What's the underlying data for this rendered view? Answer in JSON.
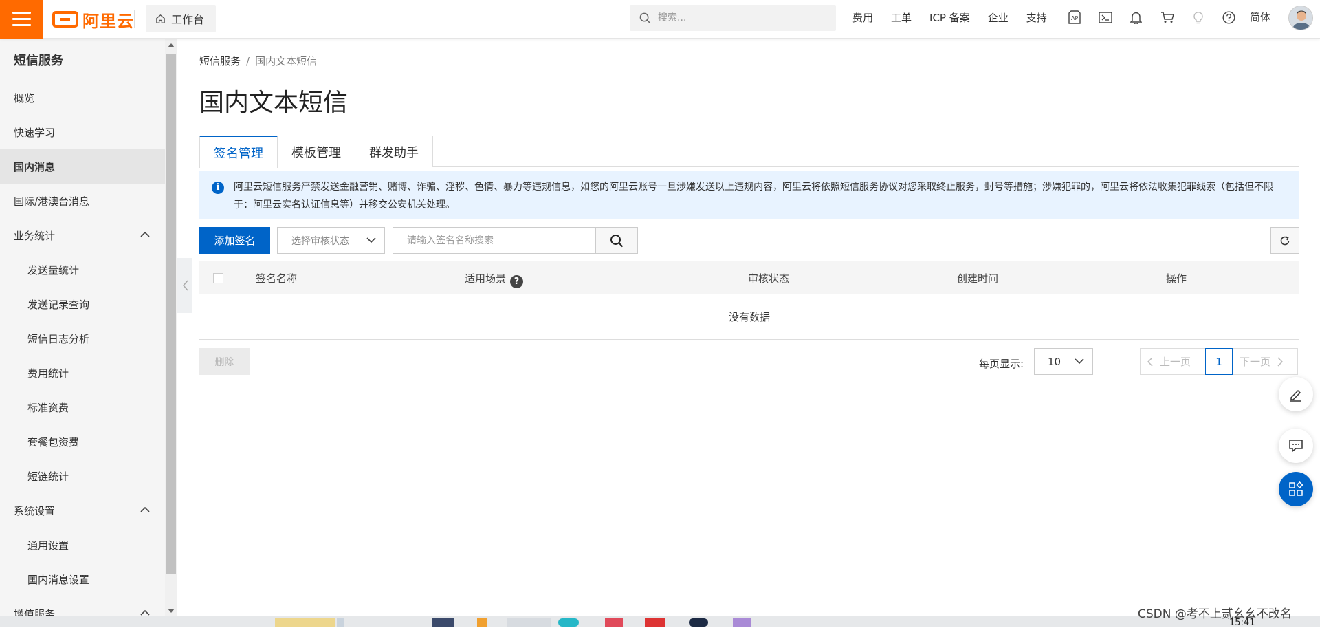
{
  "topbar": {
    "logo_text": "阿里云",
    "workbench_label": "工作台",
    "search_placeholder": "搜索...",
    "links": [
      "费用",
      "工单",
      "ICP 备案",
      "企业",
      "支持"
    ],
    "lang_label": "简体",
    "brand_color": "#ff6a00"
  },
  "sidebar": {
    "title": "短信服务",
    "items": [
      {
        "label": "概览"
      },
      {
        "label": "快速学习"
      },
      {
        "label": "国内消息"
      },
      {
        "label": "国际/港澳台消息"
      },
      {
        "label": "业务统计"
      },
      {
        "label": "发送量统计"
      },
      {
        "label": "发送记录查询"
      },
      {
        "label": "短信日志分析"
      },
      {
        "label": "费用统计"
      },
      {
        "label": "标准资费"
      },
      {
        "label": "套餐包资费"
      },
      {
        "label": "短链统计"
      },
      {
        "label": "系统设置"
      },
      {
        "label": "通用设置"
      },
      {
        "label": "国内消息设置"
      },
      {
        "label": "增值服务"
      }
    ]
  },
  "breadcrumb": {
    "root": "短信服务",
    "sep": "/",
    "current": "国内文本短信"
  },
  "page_title": "国内文本短信",
  "tabs": [
    "签名管理",
    "模板管理",
    "群发助手"
  ],
  "notice": "阿里云短信服务严禁发送金融营销、赌博、诈骗、淫秽、色情、暴力等违规信息，如您的阿里云账号一旦涉嫌发送以上违规内容，阿里云将依照短信服务协议对您采取终止服务，封号等措施；涉嫌犯罪的，阿里云将依法收集犯罪线索（包括但不限于：阿里云实名认证信息等）并移交公安机关处理。",
  "toolbar": {
    "add_label": "添加签名",
    "status_placeholder": "选择审核状态",
    "name_search_placeholder": "请输入签名名称搜索"
  },
  "table": {
    "columns": [
      "签名名称",
      "适用场景",
      "审核状态",
      "创建时间",
      "操作"
    ],
    "help_glyph": "?",
    "empty_text": "没有数据"
  },
  "footer": {
    "delete_label": "删除",
    "per_page_label": "每页显示:",
    "per_page_value": "10",
    "prev_label": "上一页",
    "current_page": "1",
    "next_label": "下一页"
  },
  "watermark": "CSDN @考不上贰幺幺不改名",
  "clock": "15:41",
  "accent_color": "#0064c8"
}
